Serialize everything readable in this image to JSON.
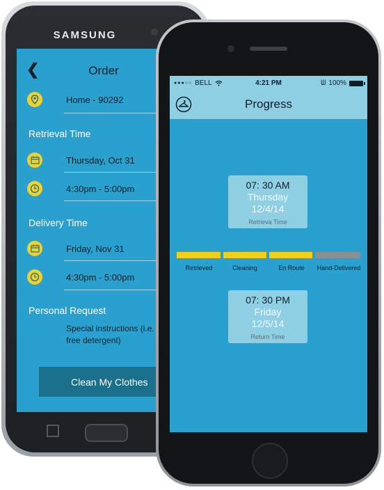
{
  "samsung": {
    "brand": "SAMSUNG",
    "header": {
      "back_icon": "chevron-left-icon",
      "title": "Order"
    },
    "address": {
      "icon": "location-pin-icon",
      "text": "Home - 90292"
    },
    "retrieval": {
      "section_label": "Retrieval Time",
      "date": {
        "icon": "calendar-icon",
        "text": "Thursday, Oct 31"
      },
      "time": {
        "icon": "clock-icon",
        "text": "4:30pm - 5:00pm"
      }
    },
    "delivery": {
      "section_label": "Delivery Time",
      "date": {
        "icon": "calendar-icon",
        "text": "Friday, Nov 31"
      },
      "time": {
        "icon": "clock-icon",
        "text": "4:30pm - 5:00pm"
      }
    },
    "personal": {
      "section_label": "Personal Request",
      "text_line1": "Special instructions (i.e.",
      "text_line2": "free detergent)"
    },
    "cta_label": "Clean My Clothes"
  },
  "iphone": {
    "status": {
      "carrier": "BELL",
      "time": "4:21 PM",
      "battery": "100%"
    },
    "nav": {
      "icon": "hanger-icon",
      "title": "Progress"
    },
    "retrieval_card": {
      "time": "07: 30 AM",
      "day": "Thursday",
      "date": "12/4/14",
      "label": "Retrieva Time"
    },
    "progress": {
      "stages": [
        "Retrieved",
        "Cleaning",
        "En Route",
        "Hand-Delivered"
      ],
      "completed_stages": 3,
      "colors": {
        "complete": "#f5cf17",
        "pending": "#8a8f93"
      }
    },
    "return_card": {
      "time": "07: 30 PM",
      "day": "Friday",
      "date": "12/5/14",
      "label": "Return Time"
    }
  },
  "colors": {
    "screen_bg": "#2aa0cf",
    "header_bg": "#8fcfe4",
    "accent_yellow": "#f2d12a",
    "cta_bg": "#1a6f8a"
  }
}
